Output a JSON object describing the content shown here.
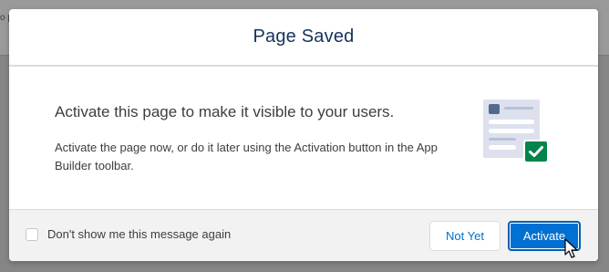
{
  "background": {
    "peek_text": "o p"
  },
  "modal": {
    "title": "Page Saved",
    "headline": "Activate this page to make it visible to your users.",
    "description": "Activate the page now, or do it later using the Activation button in the App Builder toolbar.",
    "illustration_icon": "page-activation-checkmark-illustration"
  },
  "footer": {
    "checkbox_label": "Don't show me this message again",
    "checkbox_checked": false,
    "not_yet_label": "Not Yet",
    "activate_label": "Activate"
  },
  "colors": {
    "brand": "#0070d2",
    "title": "#16325c",
    "success": "#04844b"
  }
}
